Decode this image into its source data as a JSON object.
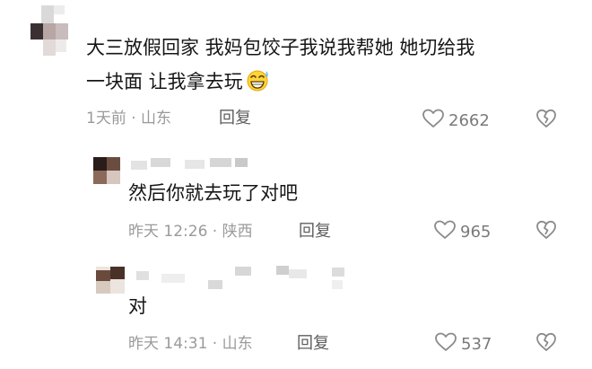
{
  "comments": [
    {
      "text_line1": "大三放假回家 我妈包饺子我说我帮她 她切给我",
      "text_line2": "一块面 让我拿去玩",
      "emoji": "grinning-sweat-emoji",
      "time": "1天前 · 山东",
      "reply_label": "回复",
      "likes": "2662"
    },
    {
      "text_line1": "然后你就去玩了对吧",
      "time": "昨天 12:26 · 陕西",
      "reply_label": "回复",
      "likes": "965"
    },
    {
      "text_line1": "对",
      "time": "昨天 14:31 · 山东",
      "reply_label": "回复",
      "likes": "537"
    }
  ],
  "colors": {
    "text": "#161616",
    "meta": "#9a9a9a",
    "reply": "#5e5e5e",
    "icon": "#8a8a8a"
  }
}
